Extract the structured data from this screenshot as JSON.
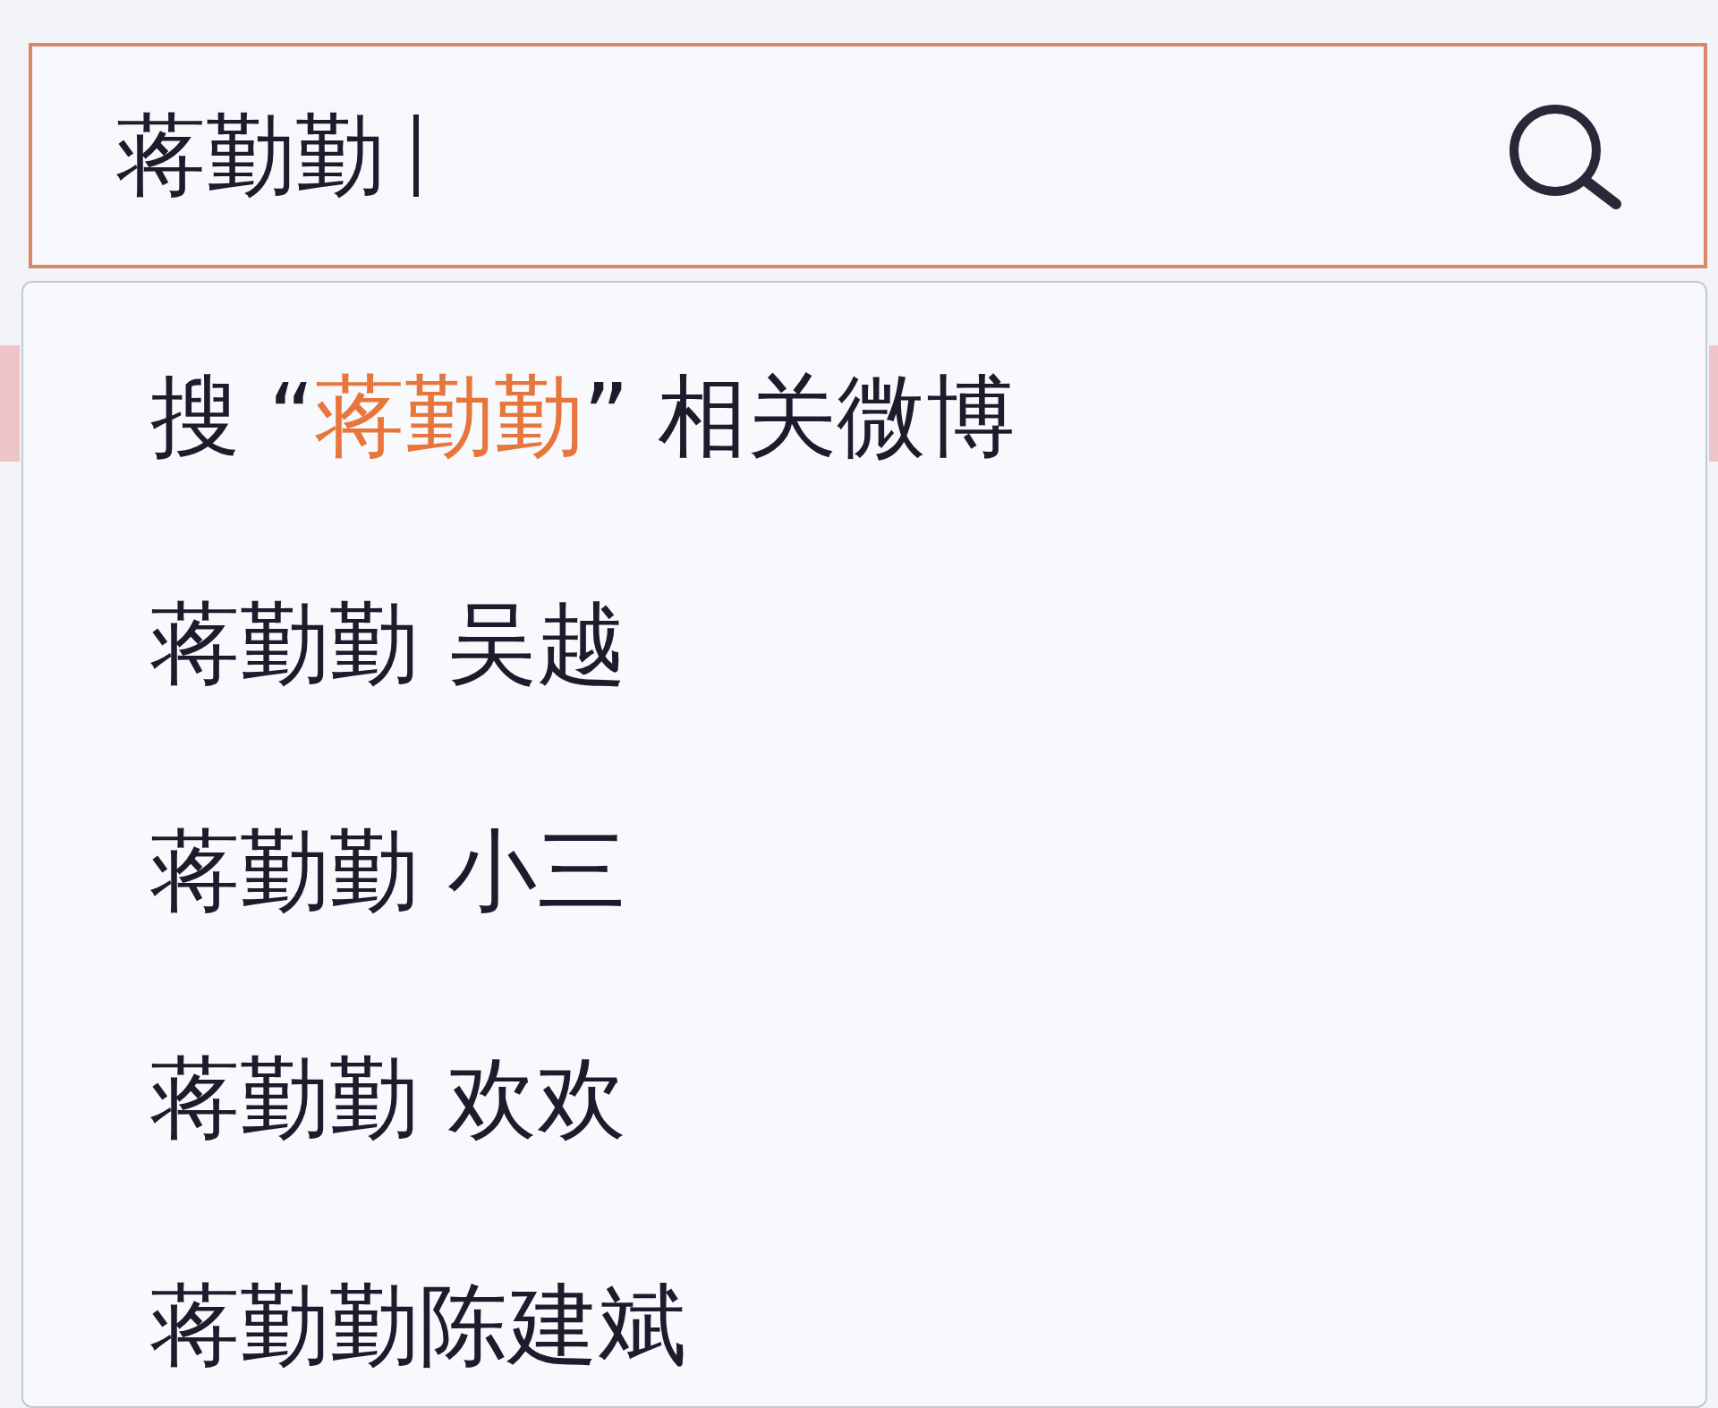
{
  "search": {
    "value": "蒋勤勤",
    "focused": true
  },
  "suggestions": [
    {
      "kind": "search_all",
      "prefix": "搜 “",
      "query": "蒋勤勤",
      "suffix": "” 相关微博"
    },
    {
      "kind": "term",
      "text": "蒋勤勤 吴越"
    },
    {
      "kind": "term",
      "text": "蒋勤勤 小三"
    },
    {
      "kind": "term",
      "text": "蒋勤勤 欢欢"
    },
    {
      "kind": "term",
      "text": "蒋勤勤陈建斌"
    }
  ]
}
